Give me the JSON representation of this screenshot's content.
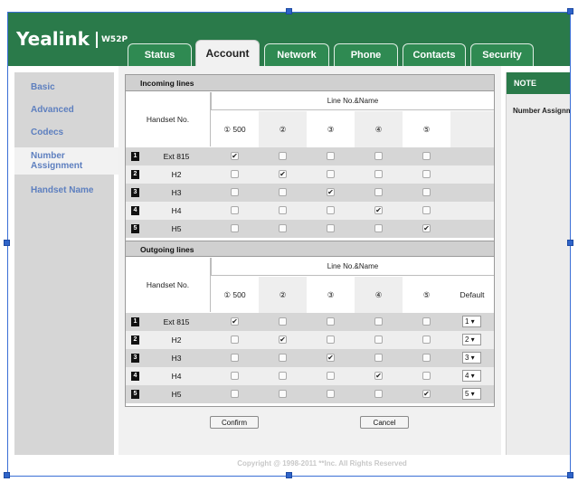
{
  "header": {
    "logo": "Yealink",
    "model": "W52P",
    "tabs": [
      {
        "label": "Status"
      },
      {
        "label": "Account"
      },
      {
        "label": "Network"
      },
      {
        "label": "Phone"
      },
      {
        "label": "Contacts"
      },
      {
        "label": "Security"
      }
    ],
    "active_tab": "Account",
    "brand_color": "#2a7a4a"
  },
  "sidebar": {
    "items": [
      {
        "label": "Basic"
      },
      {
        "label": "Advanced"
      },
      {
        "label": "Codecs"
      },
      {
        "label": "Number\nAssignment"
      },
      {
        "label": "Handset Name"
      }
    ],
    "active_item": "Number Assignment"
  },
  "incoming": {
    "title": "Incoming lines",
    "line_header": "Line No.&Name",
    "handset_header": "Handset No.",
    "columns": [
      "① 500",
      "②",
      "③",
      "④",
      "⑤"
    ],
    "rows": [
      {
        "num": "1",
        "name": "Ext 815",
        "checks": [
          true,
          false,
          false,
          false,
          false
        ]
      },
      {
        "num": "2",
        "name": "H2",
        "checks": [
          false,
          true,
          false,
          false,
          false
        ]
      },
      {
        "num": "3",
        "name": "H3",
        "checks": [
          false,
          false,
          true,
          false,
          false
        ]
      },
      {
        "num": "4",
        "name": "H4",
        "checks": [
          false,
          false,
          false,
          true,
          false
        ]
      },
      {
        "num": "5",
        "name": "H5",
        "checks": [
          false,
          false,
          false,
          false,
          true
        ]
      }
    ]
  },
  "outgoing": {
    "title": "Outgoing lines",
    "line_header": "Line No.&Name",
    "handset_header": "Handset No.",
    "columns": [
      "① 500",
      "②",
      "③",
      "④",
      "⑤"
    ],
    "default_header": "Default",
    "rows": [
      {
        "num": "1",
        "name": "Ext 815",
        "checks": [
          true,
          false,
          false,
          false,
          false
        ],
        "default": "1 ▾"
      },
      {
        "num": "2",
        "name": "H2",
        "checks": [
          false,
          true,
          false,
          false,
          false
        ],
        "default": "2 ▾"
      },
      {
        "num": "3",
        "name": "H3",
        "checks": [
          false,
          false,
          true,
          false,
          false
        ],
        "default": "3 ▾"
      },
      {
        "num": "4",
        "name": "H4",
        "checks": [
          false,
          false,
          false,
          true,
          false
        ],
        "default": "4 ▾"
      },
      {
        "num": "5",
        "name": "H5",
        "checks": [
          false,
          false,
          false,
          false,
          true
        ],
        "default": "5 ▾"
      }
    ]
  },
  "buttons": {
    "confirm": "Confirm",
    "cancel": "Cancel"
  },
  "note": {
    "title": "NOTE",
    "text": "Number Assignment"
  },
  "footer": {
    "copyright": "Copyright @ 1998-2011 **Inc. All Rights Reserved"
  }
}
